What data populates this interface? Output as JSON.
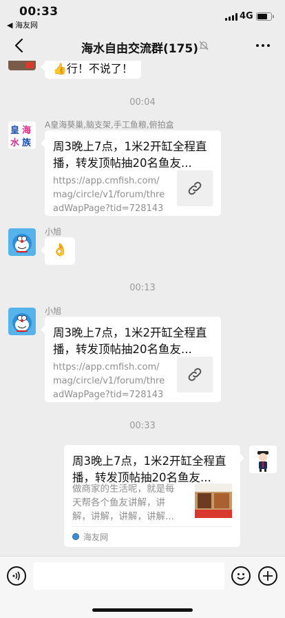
{
  "status_bar": {
    "time": "00:33",
    "back_app": "◀ 海友网",
    "network": "4G"
  },
  "nav": {
    "title": "海水自由交流群(175)"
  },
  "messages": {
    "m0": {
      "text": "👍行！不说了！"
    },
    "t1": "00:04",
    "m1": {
      "sender": "A皇海葵巢,脑支架,手工鱼粮,俯拍盒",
      "title": "周3晚上7点，1米2开缸全程直播，转发顶帖抽20名鱼友...",
      "url": "https://app.cmfish.com/mag/circle/v1/forum/threadWapPage?tid=728143&..."
    },
    "m2": {
      "sender": "小旭",
      "emoji": "👌"
    },
    "t2": "00:13",
    "m3": {
      "sender": "小旭",
      "title": "周3晚上7点，1米2开缸全程直播，转发顶帖抽20名鱼友...",
      "url": "https://app.cmfish.com/mag/circle/v1/forum/threadWapPage?tid=728143&..."
    },
    "t3": "00:33",
    "m4": {
      "title": "周3晚上7点，1米2开缸全程直播，转发顶帖抽20名鱼友...",
      "desc": "做商家的生活呢，就是每天帮各个鱼友讲解，讲解，讲解，讲解，讲解...",
      "source": "海友网"
    }
  },
  "colors": {
    "background": "#ededed",
    "bubble": "#ffffff",
    "doraemon": "#56b4ea"
  },
  "icons": {
    "nav_back": "chevron-left-icon",
    "mute": "bell-off-icon",
    "more": "more-icon",
    "link": "link-icon",
    "voice": "voice-icon",
    "emoji": "smiley-icon",
    "plus": "plus-icon"
  }
}
